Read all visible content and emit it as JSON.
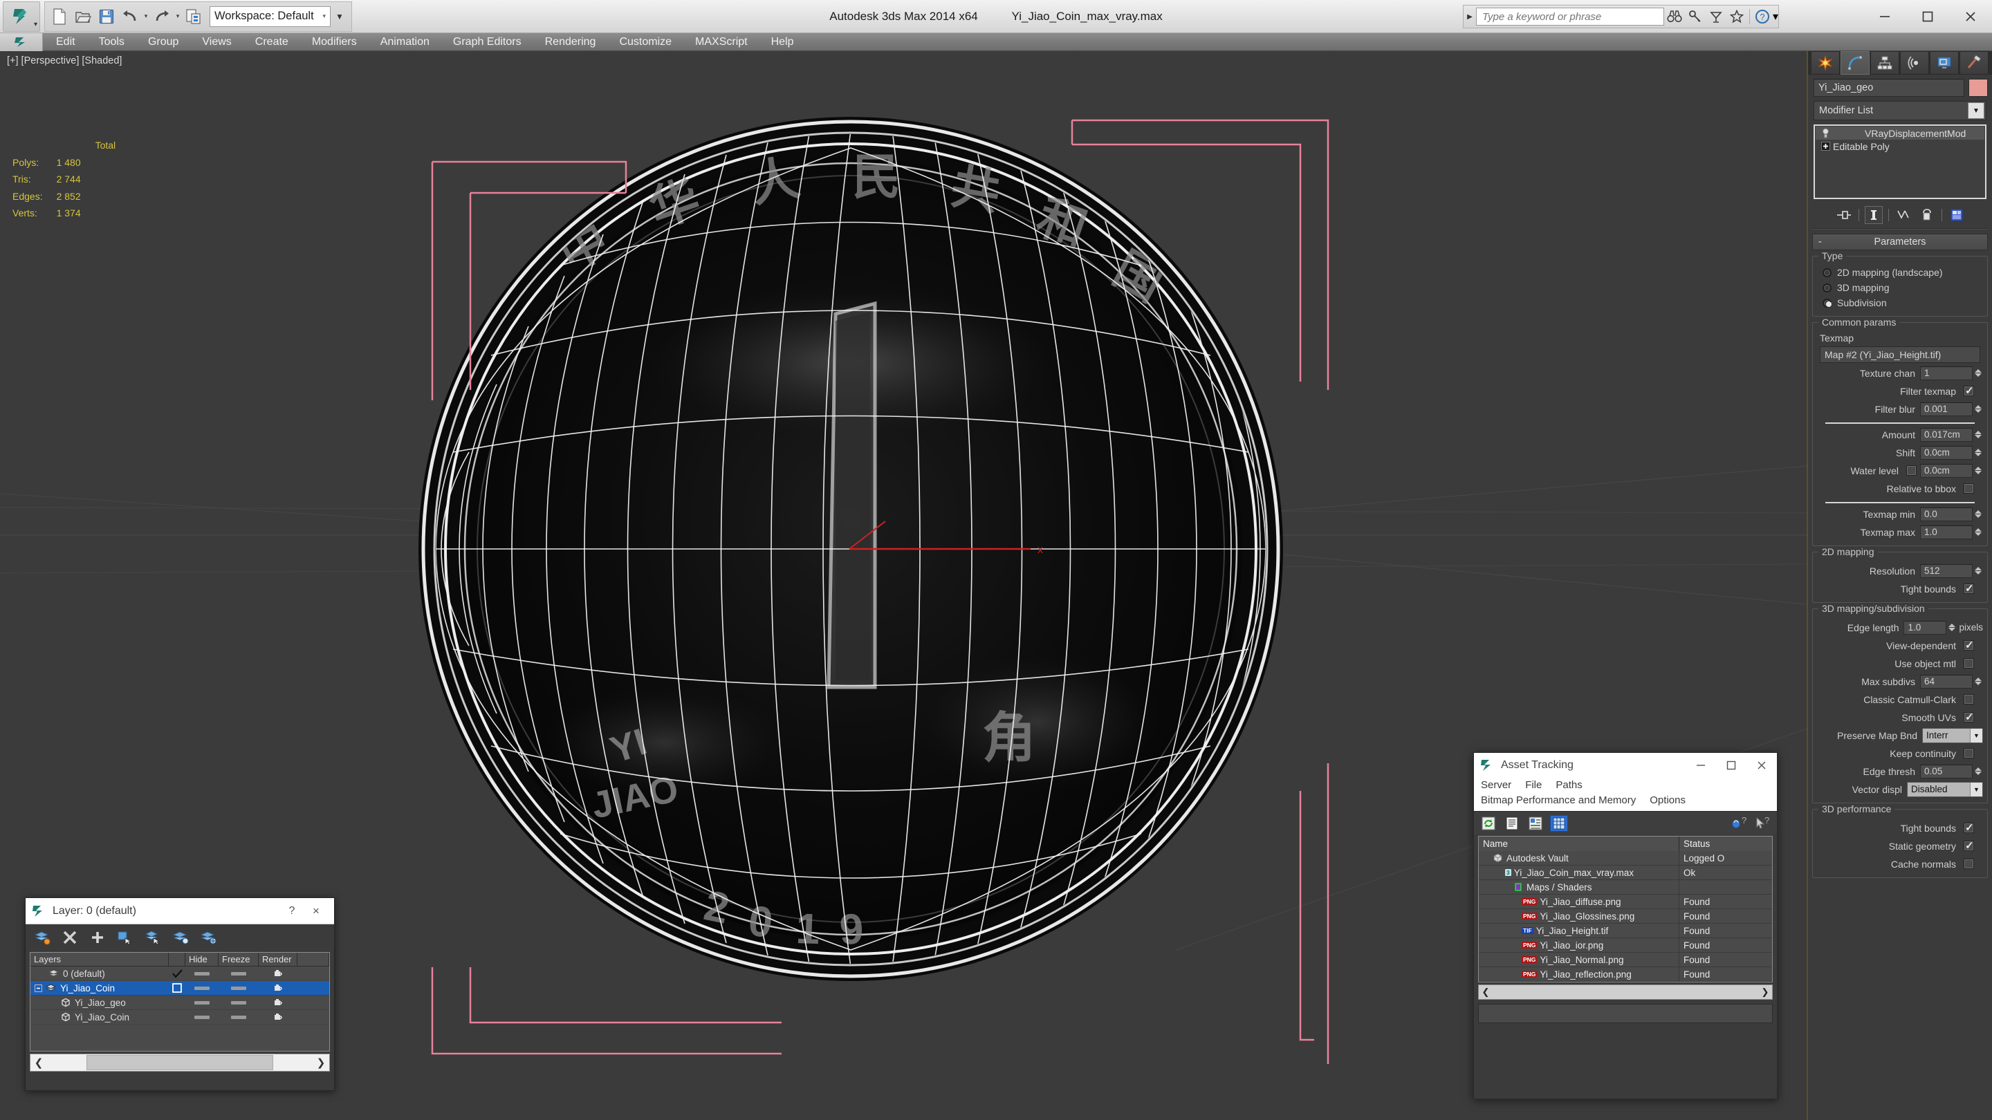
{
  "titlebar": {
    "app_title": "Autodesk 3ds Max  2014 x64",
    "file_name": "Yi_Jiao_Coin_max_vray.max",
    "workspace": "Workspace: Default",
    "quick_access": [
      "new-file-icon",
      "open-file-icon",
      "save-file-icon",
      "undo-icon",
      "redo-icon",
      "project-folder-icon"
    ],
    "window_controls": [
      "minimize-button",
      "maximize-button",
      "close-button"
    ]
  },
  "search": {
    "placeholder": "Type a keyword or phrase",
    "icons": [
      "binoculars-icon",
      "key-icon",
      "satellite-icon",
      "star-icon",
      "help-icon"
    ]
  },
  "menubar": {
    "items": [
      "Edit",
      "Tools",
      "Group",
      "Views",
      "Create",
      "Modifiers",
      "Animation",
      "Graph Editors",
      "Rendering",
      "Customize",
      "MAXScript",
      "Help"
    ]
  },
  "viewport": {
    "label": "[+] [Perspective] [Shaded]",
    "stats": {
      "header": "Total",
      "rows": [
        {
          "key": "Polys:",
          "value": "1 480"
        },
        {
          "key": "Tris:",
          "value": "2 744"
        },
        {
          "key": "Edges:",
          "value": "2 852"
        },
        {
          "key": "Verts:",
          "value": "1 374"
        }
      ]
    },
    "coin": {
      "obverse_value": "1",
      "year": "2019",
      "pinyin_top": "YI",
      "pinyin_bottom": "JIAO"
    }
  },
  "command_panel": {
    "tabs": [
      "create-tab",
      "modify-tab",
      "hierarchy-tab",
      "motion-tab",
      "display-tab",
      "utilities-tab"
    ],
    "active_tab": "modify-tab",
    "object_name": "Yi_Jiao_geo",
    "object_color": "#e79c96",
    "modifier_list_label": "Modifier List",
    "modifier_stack": [
      {
        "label": "VRayDisplacementMod",
        "selected": true
      },
      {
        "label": "Editable Poly",
        "selected": false
      }
    ],
    "stack_tools": [
      "pin-stack-icon",
      "show-end-result-icon",
      "make-unique-icon",
      "remove-modifier-icon",
      "configure-sets-icon"
    ],
    "rollout": {
      "title": "Parameters",
      "collapse": "-",
      "type_group": {
        "title": "Type",
        "options": [
          {
            "label": "2D mapping (landscape)",
            "selected": false
          },
          {
            "label": "3D mapping",
            "selected": false
          },
          {
            "label": "Subdivision",
            "selected": true
          }
        ]
      },
      "common_params": {
        "title": "Common params",
        "texmap_label": "Texmap",
        "texmap_value": "Map #2 (Yi_Jiao_Height.tif)",
        "texture_chan_label": "Texture chan",
        "texture_chan_value": "1",
        "filter_texmap_label": "Filter texmap",
        "filter_texmap_checked": true,
        "filter_blur_label": "Filter blur",
        "filter_blur_value": "0.001",
        "amount_label": "Amount",
        "amount_value": "0.017cm",
        "shift_label": "Shift",
        "shift_value": "0.0cm",
        "water_level_label": "Water level",
        "water_level_checked": false,
        "water_level_value": "0.0cm",
        "relative_bbox_label": "Relative to bbox",
        "relative_bbox_checked": false,
        "texmap_min_label": "Texmap min",
        "texmap_min_value": "0.0",
        "texmap_max_label": "Texmap max",
        "texmap_max_value": "1.0"
      },
      "mapping_2d": {
        "title": "2D mapping",
        "resolution_label": "Resolution",
        "resolution_value": "512",
        "tight_bounds_label": "Tight bounds",
        "tight_bounds_checked": true
      },
      "mapping_3d": {
        "title": "3D mapping/subdivision",
        "edge_length_label": "Edge length",
        "edge_length_value": "1.0",
        "edge_length_units": "pixels",
        "view_dependent_label": "View-dependent",
        "view_dependent_checked": true,
        "use_object_mtl_label": "Use object mtl",
        "use_object_mtl_checked": false,
        "max_subdivs_label": "Max subdivs",
        "max_subdivs_value": "64",
        "classic_cc_label": "Classic Catmull-Clark",
        "classic_cc_checked": false,
        "smooth_uvs_label": "Smooth UVs",
        "smooth_uvs_checked": true,
        "preserve_map_label": "Preserve Map Bnd",
        "preserve_map_value": "Interr",
        "keep_continuity_label": "Keep continuity",
        "keep_continuity_checked": false,
        "edge_thresh_label": "Edge thresh",
        "edge_thresh_value": "0.05",
        "vector_displ_label": "Vector displ",
        "vector_displ_value": "Disabled"
      },
      "performance_3d": {
        "title": "3D performance",
        "tight_bounds_label": "Tight bounds",
        "tight_bounds_checked": true,
        "static_geometry_label": "Static geometry",
        "static_geometry_checked": true,
        "cache_normals_label": "Cache normals",
        "cache_normals_checked": false
      }
    }
  },
  "layer_dialog": {
    "title": "Layer: 0 (default)",
    "help_label": "?",
    "close_label": "×",
    "toolbar": [
      "create-new-layer-icon",
      "delete-layer-icon",
      "add-layer-icon",
      "select-objects-icon",
      "select-highlight-icon",
      "set-current-icon",
      "layer-properties-icon"
    ],
    "columns": [
      "Layers",
      "",
      "Hide",
      "Freeze",
      "Render"
    ],
    "rows": [
      {
        "name": "0 (default)",
        "indent": 1,
        "icon": "layers-icon",
        "current": "check",
        "selected": false
      },
      {
        "name": "Yi_Jiao_Coin",
        "indent": 0,
        "icon": "layers-icon",
        "current": "box",
        "selected": true,
        "expander": "-"
      },
      {
        "name": "Yi_Jiao_geo",
        "indent": 2,
        "icon": "object-icon",
        "current": "",
        "selected": false
      },
      {
        "name": "Yi_Jiao_Coin",
        "indent": 2,
        "icon": "object-icon",
        "current": "",
        "selected": false
      }
    ]
  },
  "asset_tracking": {
    "title": "Asset Tracking",
    "window_controls": [
      "minimize-button",
      "maximize-button",
      "close-button"
    ],
    "menus_row1": [
      "Server",
      "File",
      "Paths"
    ],
    "menus_row2": [
      "Bitmap Performance and Memory",
      "Options"
    ],
    "toolbar": [
      "refresh-icon",
      "list-view-icon",
      "detail-view-icon",
      "grid-view-icon"
    ],
    "help_icons": [
      "add-help-icon",
      "help-arrow-icon"
    ],
    "columns": [
      "Name",
      "Status"
    ],
    "rows": [
      {
        "name": "Autodesk Vault",
        "status": "Logged O",
        "indent": 1,
        "type": "vault"
      },
      {
        "name": "Yi_Jiao_Coin_max_vray.max",
        "status": "Ok",
        "indent": 2,
        "type": "max"
      },
      {
        "name": "Maps / Shaders",
        "status": "",
        "indent": 3,
        "type": "maps"
      },
      {
        "name": "Yi_Jiao_diffuse.png",
        "status": "Found",
        "indent": 4,
        "type": "png"
      },
      {
        "name": "Yi_Jiao_Glossines.png",
        "status": "Found",
        "indent": 4,
        "type": "png"
      },
      {
        "name": "Yi_Jiao_Height.tif",
        "status": "Found",
        "indent": 4,
        "type": "tif"
      },
      {
        "name": "Yi_Jiao_ior.png",
        "status": "Found",
        "indent": 4,
        "type": "png"
      },
      {
        "name": "Yi_Jiao_Normal.png",
        "status": "Found",
        "indent": 4,
        "type": "png"
      },
      {
        "name": "Yi_Jiao_reflection.png",
        "status": "Found",
        "indent": 4,
        "type": "png"
      }
    ]
  }
}
